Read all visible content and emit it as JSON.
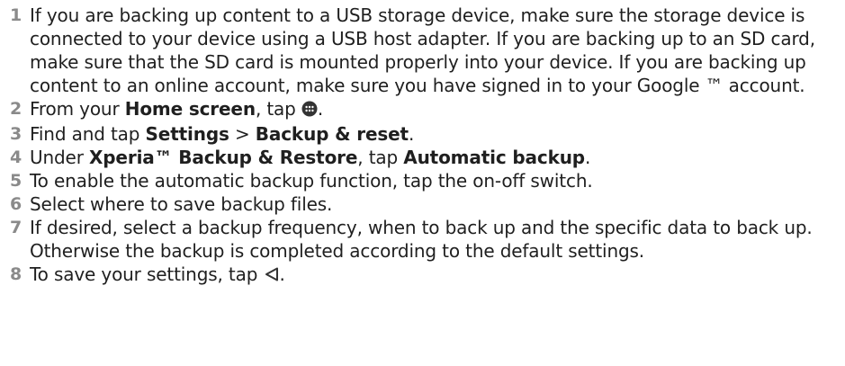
{
  "steps": [
    {
      "number": "1",
      "text": "If you are backing up content to a USB storage device, make sure the storage device is connected to your device using a USB host adapter. If you are backing up to an SD card, make sure that the SD card is mounted properly into your device. If you are backing up content to an online account, make sure you have signed in to your Google ™ account."
    },
    {
      "number": "2",
      "part1": "From your ",
      "bold1": "Home screen",
      "part2": ", tap ",
      "icon": "apps-grid-icon",
      "part3": "."
    },
    {
      "number": "3",
      "part1": "Find and tap ",
      "bold1": "Settings",
      "part2": " > ",
      "bold2": "Backup & reset",
      "part3": "."
    },
    {
      "number": "4",
      "part1": "Under ",
      "bold1": "Xperia™ Backup & Restore",
      "part2": ", tap ",
      "bold2": "Automatic backup",
      "part3": "."
    },
    {
      "number": "5",
      "text": "To enable the automatic backup function, tap the on-off switch."
    },
    {
      "number": "6",
      "text": "Select where to save backup files."
    },
    {
      "number": "7",
      "text": "If desired, select a backup frequency, when to back up and the specific data to back up. Otherwise the backup is completed according to the default settings."
    },
    {
      "number": "8",
      "part1": "To save your settings, tap ",
      "icon": "back-triangle-icon",
      "part2": "."
    }
  ]
}
